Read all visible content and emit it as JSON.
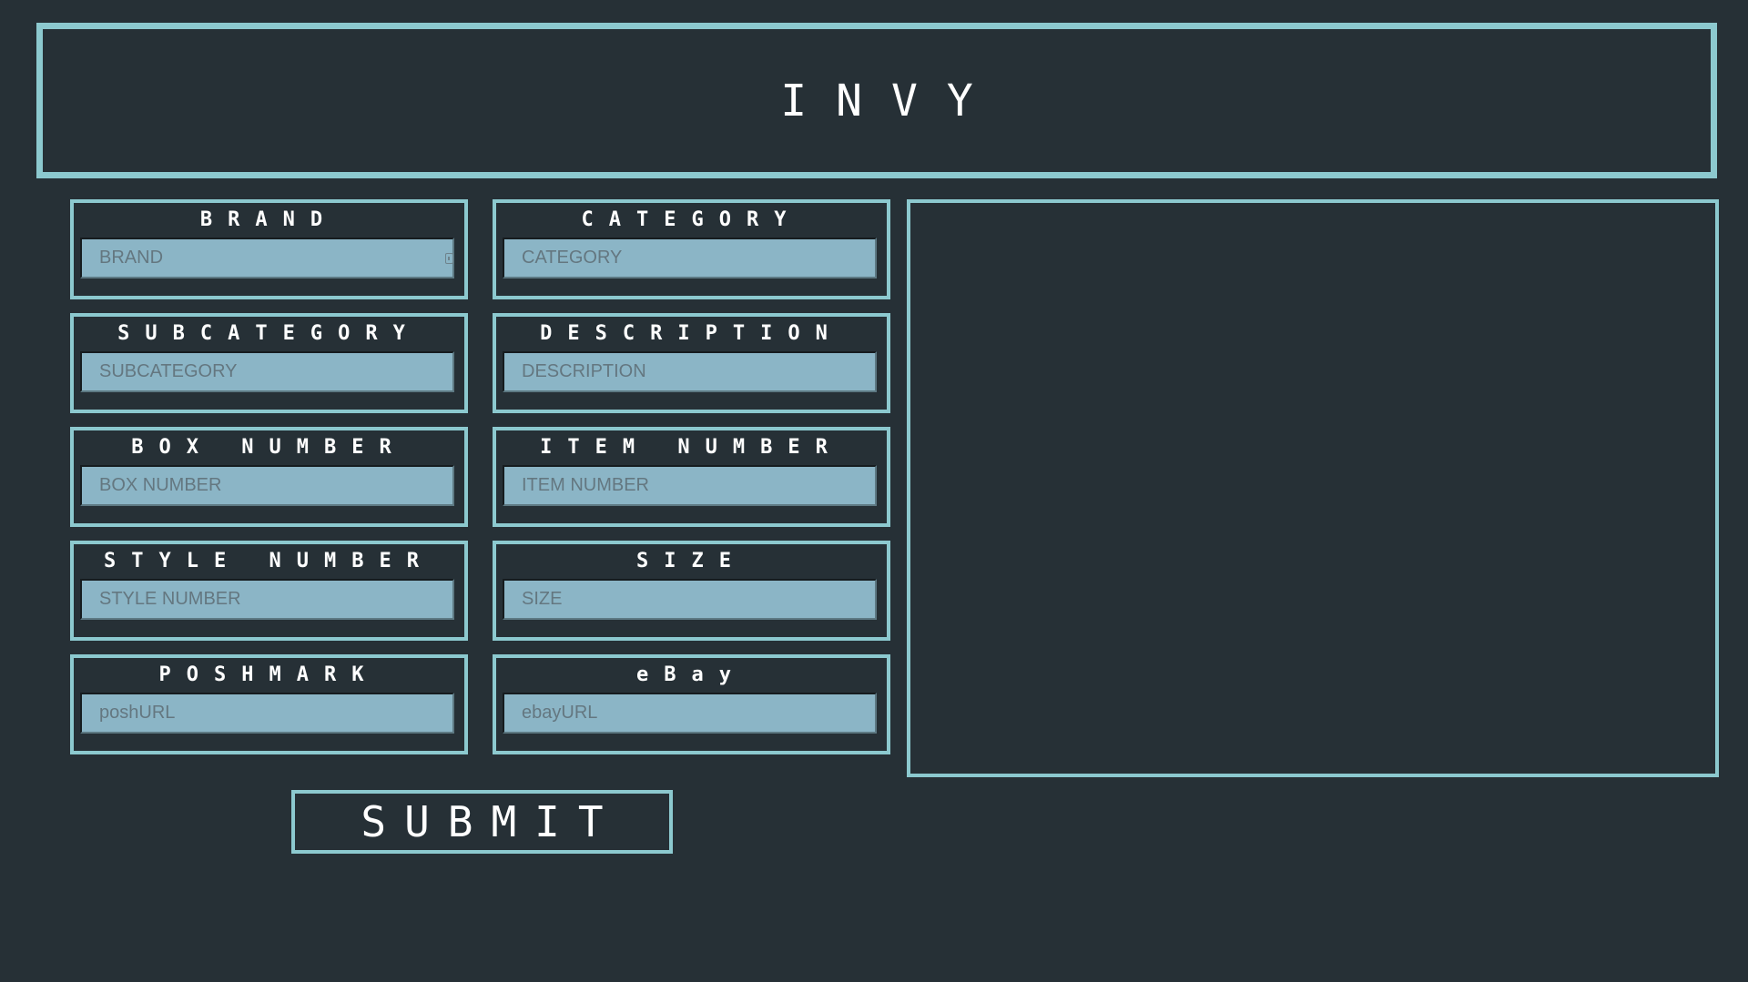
{
  "app": {
    "title": "INVY"
  },
  "fields": {
    "brand": {
      "label": "BRAND",
      "placeholder": "BRAND"
    },
    "category": {
      "label": "CATEGORY",
      "placeholder": "CATEGORY"
    },
    "subcategory": {
      "label": "SUBCATEGORY",
      "placeholder": "SUBCATEGORY"
    },
    "description": {
      "label": "DESCRIPTION",
      "placeholder": "DESCRIPTION"
    },
    "box_number": {
      "label": "BOX NUMBER",
      "placeholder": "BOX NUMBER"
    },
    "item_number": {
      "label": "ITEM NUMBER",
      "placeholder": "ITEM NUMBER"
    },
    "style_number": {
      "label": "STYLE NUMBER",
      "placeholder": "STYLE NUMBER"
    },
    "size": {
      "label": "SIZE",
      "placeholder": "SIZE"
    },
    "poshmark": {
      "label": "POSHMARK",
      "placeholder": "poshURL"
    },
    "ebay": {
      "label": "eBay",
      "placeholder": "ebayURL"
    }
  },
  "actions": {
    "submit_label": "SUBMIT"
  },
  "icons": {
    "autofill": "autofill-icon"
  },
  "colors": {
    "background": "#263036",
    "accent": "#8cc9cf",
    "input_background": "#8bb5c6",
    "label_text": "#ffffff",
    "placeholder_text": "#647780"
  }
}
